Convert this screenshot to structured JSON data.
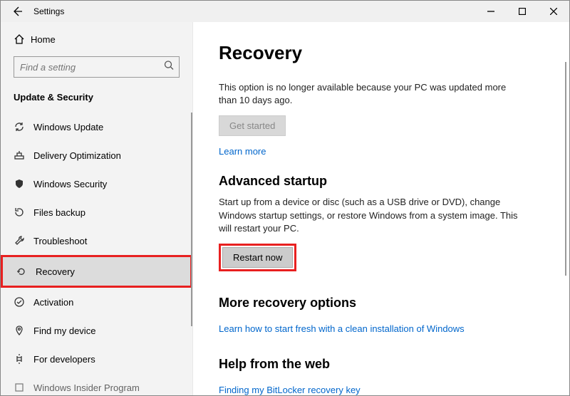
{
  "titlebar": {
    "title": "Settings"
  },
  "sidebar": {
    "home": "Home",
    "search_placeholder": "Find a setting",
    "section": "Update & Security",
    "items": [
      {
        "label": "Windows Update"
      },
      {
        "label": "Delivery Optimization"
      },
      {
        "label": "Windows Security"
      },
      {
        "label": "Files backup"
      },
      {
        "label": "Troubleshoot"
      },
      {
        "label": "Recovery"
      },
      {
        "label": "Activation"
      },
      {
        "label": "Find my device"
      },
      {
        "label": "For developers"
      },
      {
        "label": "Windows Insider Program"
      }
    ]
  },
  "content": {
    "title": "Recovery",
    "go_back_desc": "This option is no longer available because your PC was updated more than 10 days ago.",
    "get_started": "Get started",
    "learn_more": "Learn more",
    "advanced_title": "Advanced startup",
    "advanced_desc": "Start up from a device or disc (such as a USB drive or DVD), change Windows startup settings, or restore Windows from a system image. This will restart your PC.",
    "restart_now": "Restart now",
    "more_title": "More recovery options",
    "more_link": "Learn how to start fresh with a clean installation of Windows",
    "help_title": "Help from the web",
    "help_link": "Finding my BitLocker recovery key"
  }
}
